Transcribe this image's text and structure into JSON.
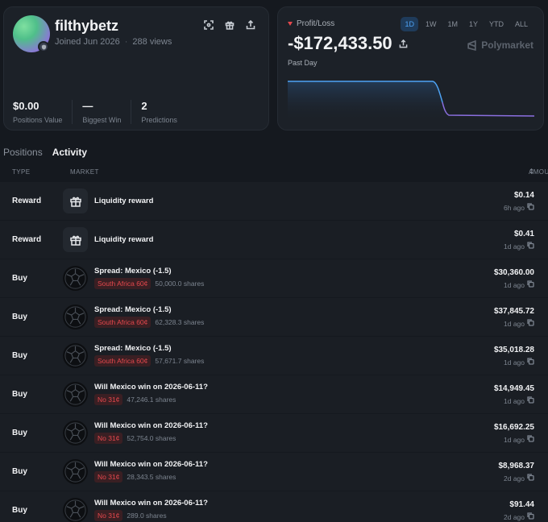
{
  "profile": {
    "username": "filthybetz",
    "joined": "Joined Jun 2026",
    "views": "288 views",
    "stats": [
      {
        "value": "$0.00",
        "label": "Positions Value"
      },
      {
        "value": "—",
        "label": "Biggest Win"
      },
      {
        "value": "2",
        "label": "Predictions"
      }
    ]
  },
  "pnl": {
    "label": "Profit/Loss",
    "value": "-$172,433.50",
    "period": "Past Day",
    "brand": "Polymarket",
    "ranges": [
      "1D",
      "1W",
      "1M",
      "1Y",
      "YTD",
      "ALL"
    ],
    "active_range": "1D",
    "colors": {
      "line_before": "#4ea3f5",
      "line_after": "#8b6fe0",
      "down": "#e5484d"
    }
  },
  "tabs": [
    {
      "label": "Positions",
      "active": false
    },
    {
      "label": "Activity",
      "active": true
    }
  ],
  "table": {
    "headers": {
      "type": "TYPE",
      "market": "MARKET",
      "amount": "AMOUNT"
    },
    "rows": [
      {
        "type": "Reward",
        "icon": "gift-icon",
        "title": "Liquidity reward",
        "outcome": "",
        "shares": "",
        "amount": "$0.14",
        "time": "6h ago"
      },
      {
        "type": "Reward",
        "icon": "gift-icon",
        "title": "Liquidity reward",
        "outcome": "",
        "shares": "",
        "amount": "$0.41",
        "time": "1d ago"
      },
      {
        "type": "Buy",
        "icon": "soccer-ball-icon",
        "title": "Spread: Mexico (-1.5)",
        "outcome": "South Africa 60¢",
        "shares": "50,000.0 shares",
        "amount": "$30,360.00",
        "time": "1d ago"
      },
      {
        "type": "Buy",
        "icon": "soccer-ball-icon",
        "title": "Spread: Mexico (-1.5)",
        "outcome": "South Africa 60¢",
        "shares": "62,328.3 shares",
        "amount": "$37,845.72",
        "time": "1d ago"
      },
      {
        "type": "Buy",
        "icon": "soccer-ball-icon",
        "title": "Spread: Mexico (-1.5)",
        "outcome": "South Africa 60¢",
        "shares": "57,671.7 shares",
        "amount": "$35,018.28",
        "time": "1d ago"
      },
      {
        "type": "Buy",
        "icon": "soccer-ball-icon",
        "title": "Will Mexico win on 2026-06-11?",
        "outcome": "No 31¢",
        "shares": "47,246.1 shares",
        "amount": "$14,949.45",
        "time": "1d ago"
      },
      {
        "type": "Buy",
        "icon": "soccer-ball-icon",
        "title": "Will Mexico win on 2026-06-11?",
        "outcome": "No 31¢",
        "shares": "52,754.0 shares",
        "amount": "$16,692.25",
        "time": "1d ago"
      },
      {
        "type": "Buy",
        "icon": "soccer-ball-icon",
        "title": "Will Mexico win on 2026-06-11?",
        "outcome": "No 31¢",
        "shares": "28,343.5 shares",
        "amount": "$8,968.37",
        "time": "2d ago"
      },
      {
        "type": "Buy",
        "icon": "soccer-ball-icon",
        "title": "Will Mexico win on 2026-06-11?",
        "outcome": "No 31¢",
        "shares": "289.0 shares",
        "amount": "$91.44",
        "time": "2d ago"
      }
    ]
  }
}
